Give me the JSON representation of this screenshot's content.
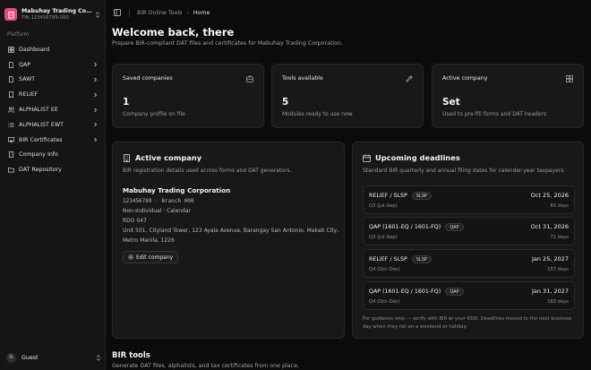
{
  "sidebar": {
    "org_name": "Mabuhay Trading Corp...",
    "org_tin": "TIN 123456789-000",
    "section_label": "Platform",
    "items": [
      {
        "label": "Dashboard",
        "icon": "grid-icon",
        "chevron": false
      },
      {
        "label": "QAP",
        "icon": "file-icon",
        "chevron": true
      },
      {
        "label": "SAWT",
        "icon": "file-icon",
        "chevron": true
      },
      {
        "label": "RELIEF",
        "icon": "receipt-icon",
        "chevron": true
      },
      {
        "label": "ALPHALIST EE",
        "icon": "users-icon",
        "chevron": true
      },
      {
        "label": "ALPHALIST EWT",
        "icon": "list-icon",
        "chevron": true
      },
      {
        "label": "BIR Certificates",
        "icon": "certificate-icon",
        "chevron": true
      },
      {
        "label": "Company Info",
        "icon": "building-icon",
        "chevron": false
      },
      {
        "label": "DAT Repository",
        "icon": "folder-icon",
        "chevron": false
      }
    ],
    "user": {
      "initial": "G",
      "name": "Guest"
    }
  },
  "header": {
    "breadcrumb": [
      "BIR Online Tools",
      "Home"
    ]
  },
  "page": {
    "title": "Welcome back, there",
    "subtitle": "Prepare BIR-compliant DAT files and certificates for Mabuhay Trading Corporation."
  },
  "stats": [
    {
      "title": "Saved companies",
      "icon": "briefcase-icon",
      "value": "1",
      "sub": "Company profile on file"
    },
    {
      "title": "Tools available",
      "icon": "wrench-icon",
      "value": "5",
      "sub": "Modules ready to use now"
    },
    {
      "title": "Active company",
      "icon": "grid-icon",
      "value": "Set",
      "sub": "Used to pre-fill forms and DAT headers"
    }
  ],
  "active_company": {
    "title": "Active company",
    "description": "BIR registration details used across forms and DAT generators.",
    "name": "Mabuhay Trading Corporation",
    "tin_line": "123456789  ·  Branch 000",
    "type": "Non-Individual · Calendar",
    "rdo": "RDO 047",
    "address_1": "Unit 501, Cityland Tower, 123 Ayala Avenue, Barangay San Antonio, Makati City,",
    "address_2": "Metro Manila, 1226",
    "edit_label": "Edit company"
  },
  "deadlines": {
    "title": "Upcoming deadlines",
    "description": "Standard BIR quarterly and annual filing dates for calendar-year taxpayers.",
    "items": [
      {
        "name": "RELIEF / SLSP",
        "badge": "SLSP",
        "period": "Q3 (Jul–Sep)",
        "date": "Oct 25, 2026",
        "days": "65 days"
      },
      {
        "name": "QAP (1601-EQ / 1601-FQ)",
        "badge": "QAP",
        "period": "Q3 (Jul–Sep)",
        "date": "Oct 31, 2026",
        "days": "71 days"
      },
      {
        "name": "RELIEF / SLSP",
        "badge": "SLSP",
        "period": "Q4 (Oct–Dec)",
        "date": "Jan 25, 2027",
        "days": "157 days"
      },
      {
        "name": "QAP (1601-EQ / 1601-FQ)",
        "badge": "QAP",
        "period": "Q4 (Oct–Dec)",
        "date": "Jan 31, 2027",
        "days": "163 days"
      }
    ],
    "note": "For guidance only — verify with BIR or your RDO. Deadlines moved to the next business day when they fall on a weekend or holiday."
  },
  "tools": {
    "title": "BIR tools",
    "description": "Generate DAT files, alphalists, and tax certificates from one place."
  }
}
